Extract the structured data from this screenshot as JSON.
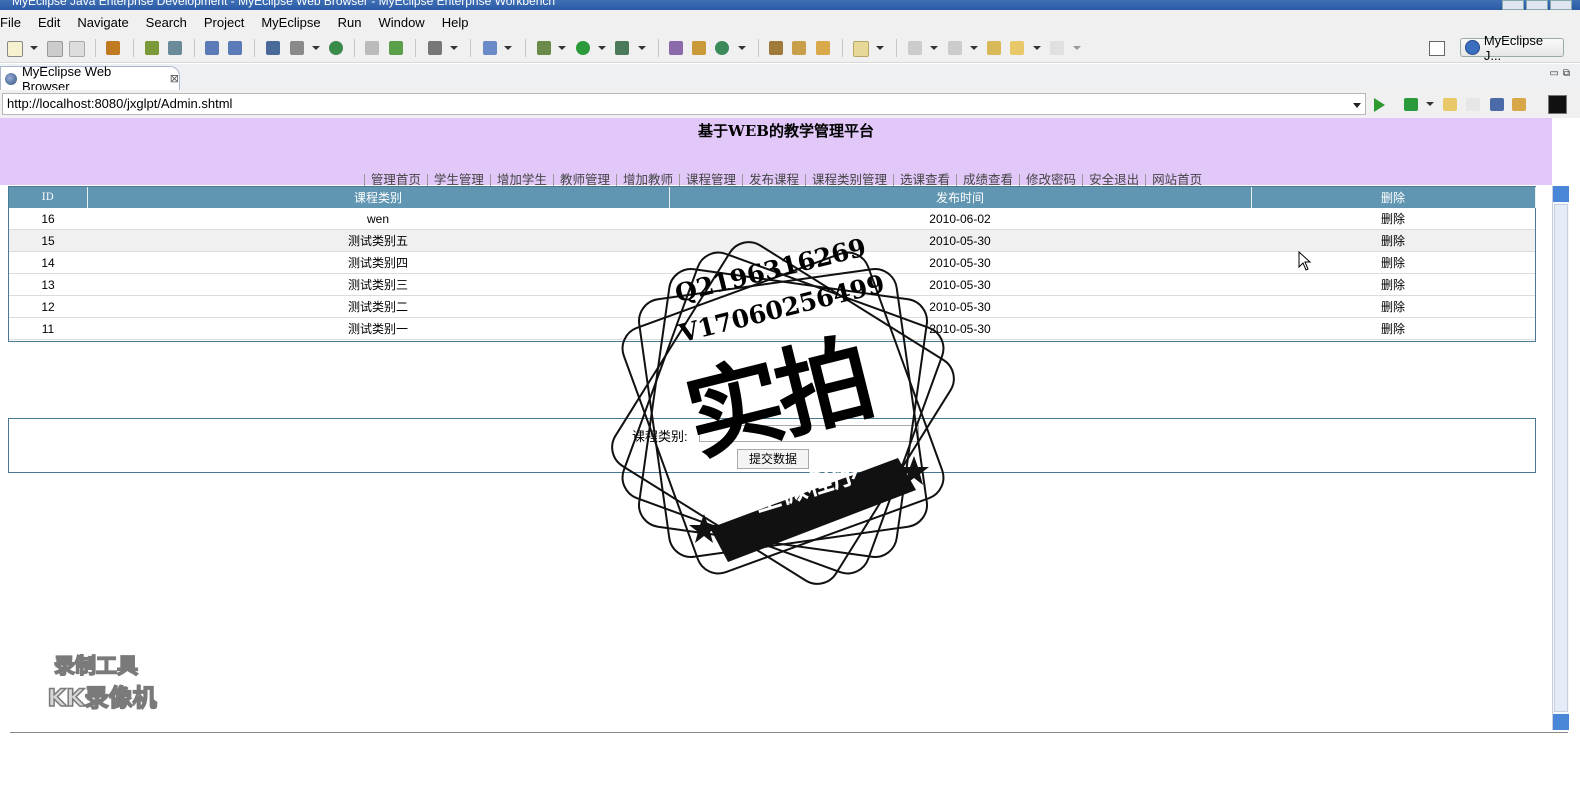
{
  "window": {
    "title": "MyEclipse Java Enterprise Development - MyEclipse Web Browser - MyEclipse Enterprise Workbench"
  },
  "menu": [
    "File",
    "Edit",
    "Navigate",
    "Search",
    "Project",
    "MyEclipse",
    "Run",
    "Window",
    "Help"
  ],
  "perspective": {
    "label": "MyEclipse J..."
  },
  "editor_tab": {
    "label": "MyEclipse Web Browser",
    "close": "⊠"
  },
  "browser": {
    "url": "http://localhost:8080/jxglpt/Admin.shtml"
  },
  "page": {
    "title": "基于WEB的教学管理平台",
    "nav": [
      "管理首页",
      "学生管理",
      "增加学生",
      "教师管理",
      "增加教师",
      "课程管理",
      "发布课程",
      "课程类别管理",
      "选课查看",
      "成绩查看",
      "修改密码",
      "安全退出",
      "网站首页"
    ],
    "table": {
      "columns": [
        "ID",
        "课程类别",
        "发布时间",
        "删除"
      ],
      "rows": [
        {
          "id": "16",
          "category": "wen",
          "date": "2010-06-02",
          "action": "删除"
        },
        {
          "id": "15",
          "category": "测试类别五",
          "date": "2010-05-30",
          "action": "删除"
        },
        {
          "id": "14",
          "category": "测试类别四",
          "date": "2010-05-30",
          "action": "删除"
        },
        {
          "id": "13",
          "category": "测试类别三",
          "date": "2010-05-30",
          "action": "删除"
        },
        {
          "id": "12",
          "category": "测试类别二",
          "date": "2010-05-30",
          "action": "删除"
        },
        {
          "id": "11",
          "category": "测试类别一",
          "date": "2010-05-30",
          "action": "删除"
        }
      ]
    },
    "form": {
      "label": "课程类别:",
      "input_value": "",
      "submit_label": "提交数据"
    }
  },
  "watermark": {
    "line1": "Q2196316269",
    "line2": "V17060256499",
    "big": "实拍",
    "ribbon": "全微程序",
    "recorder_line1": "录制工具",
    "recorder_line2": "KK录像机"
  },
  "colors": {
    "header_bg": "#e1c8f9",
    "table_header_bg": "#6196b2",
    "row_alt_bg": "#f0f0f0",
    "titlebar": "#2b5aa6"
  },
  "icons": {
    "go": "play-triangle-icon",
    "tab": "globe-icon",
    "perspective": "myeclipse-perspective-icon"
  }
}
